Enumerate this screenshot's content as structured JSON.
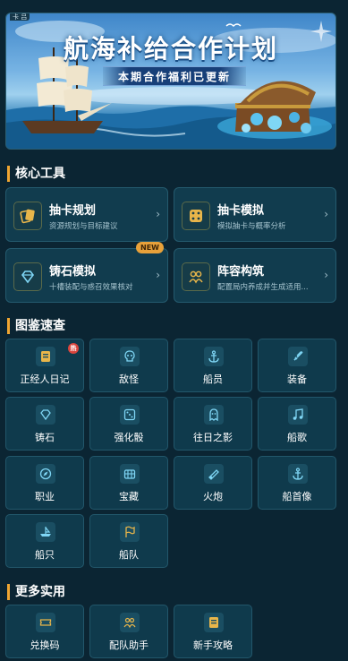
{
  "banner": {
    "tag": "卡 吕",
    "title": "航海补给合作计划",
    "subtitle": "本期合作福利已更新"
  },
  "sections": {
    "core_tools": "核心工具",
    "catalog": "图鉴速查",
    "more": "更多实用"
  },
  "tools": [
    {
      "name": "抽卡规划",
      "desc": "资源规划与目标建议",
      "icon": "cards-icon"
    },
    {
      "name": "抽卡模拟",
      "desc": "模拟抽卡与概率分析",
      "icon": "dice-icon"
    },
    {
      "name": "铸石模拟",
      "desc": "十槽装配与惑召效果核对",
      "icon": "gem-icon",
      "badge": "NEW"
    },
    {
      "name": "阵容构筑",
      "desc": "配置局内养成并生成适用...",
      "icon": "team-icon"
    }
  ],
  "catalog": [
    {
      "label": "正经人日记",
      "icon": "book-icon",
      "badge": "热"
    },
    {
      "label": "敌怪",
      "icon": "skull-icon"
    },
    {
      "label": "船员",
      "icon": "anchor-icon"
    },
    {
      "label": "装备",
      "icon": "sword-icon"
    },
    {
      "label": "铸石",
      "icon": "gem-icon"
    },
    {
      "label": "强化骰",
      "icon": "dice-icon"
    },
    {
      "label": "往日之影",
      "icon": "ghost-icon"
    },
    {
      "label": "船歌",
      "icon": "music-icon"
    },
    {
      "label": "职业",
      "icon": "compass-icon"
    },
    {
      "label": "宝藏",
      "icon": "chest-icon"
    },
    {
      "label": "火炮",
      "icon": "cannon-icon"
    },
    {
      "label": "船首像",
      "icon": "anchor-icon"
    },
    {
      "label": "船只",
      "icon": "ship-icon"
    },
    {
      "label": "船队",
      "icon": "flag-icon"
    }
  ],
  "more": [
    {
      "label": "兑换码",
      "icon": "ticket-icon"
    },
    {
      "label": "配队助手",
      "icon": "team-icon"
    },
    {
      "label": "新手攻略",
      "icon": "book-icon"
    }
  ],
  "colors": {
    "accent": "#f0a632",
    "background": "#0b2533",
    "card": "#113c4e",
    "badge_new": "#e8a13a",
    "badge_hot": "#d9443c"
  }
}
